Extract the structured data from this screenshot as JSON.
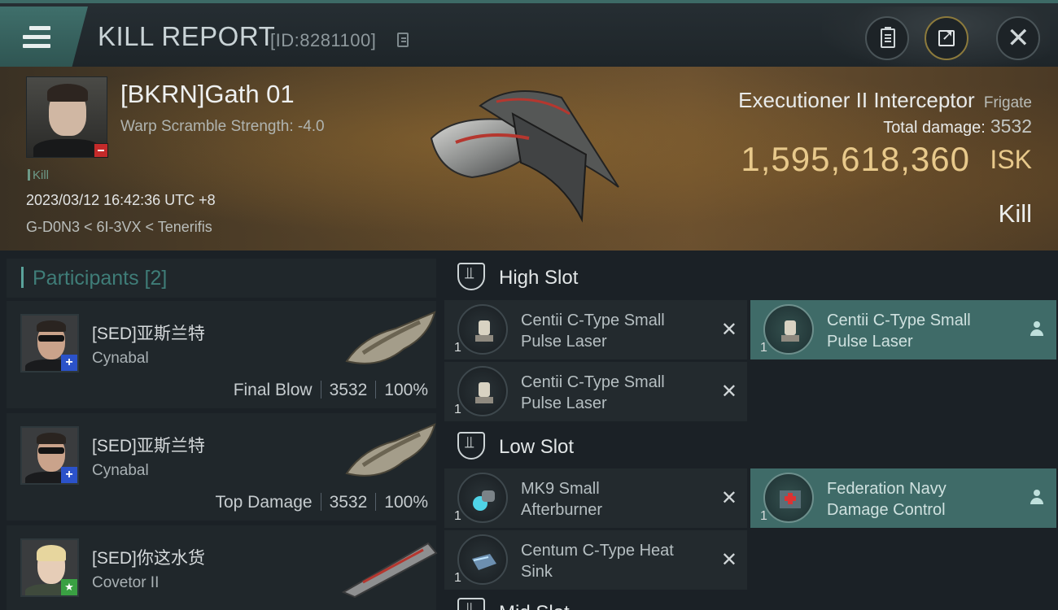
{
  "titlebar": {
    "title": "KILL REPORT",
    "report_id": "[ID:8281100]"
  },
  "victim": {
    "name": "[BKRN]Gath 01",
    "warp_scramble": "Warp Scramble Strength: -4.0",
    "tag": "Kill",
    "timestamp": "2023/03/12 16:42:36 UTC +8",
    "location": "G-D0N3 < 6I-3VX < Tenerifis",
    "ship_type": "Executioner II Interceptor",
    "ship_class": "Frigate",
    "total_damage_label": "Total damage:",
    "total_damage_value": "3532",
    "isk_value": "1,595,618,360",
    "isk_unit": "ISK",
    "result": "Kill"
  },
  "participants": {
    "title": "Participants [2]",
    "items": [
      {
        "name": "[SED]亚斯兰特",
        "ship": "Cynabal",
        "role": "Final Blow",
        "damage": "3532",
        "percent": "100%",
        "standing": "+"
      },
      {
        "name": "[SED]亚斯兰特",
        "ship": "Cynabal",
        "role": "Top Damage",
        "damage": "3532",
        "percent": "100%",
        "standing": "+"
      },
      {
        "name": "[SED]你这水货",
        "ship": "Covetor II",
        "standing": "★"
      }
    ]
  },
  "slots": {
    "high_title": "High Slot",
    "low_title": "Low Slot",
    "mid_title": "Mid Slot",
    "modules": [
      {
        "name_line1": "Centii C-Type Small",
        "name_line2": "Pulse Laser",
        "qty": "1",
        "state": "destroyed",
        "icon": "laser-icon"
      },
      {
        "name_line1": "Centii C-Type Small",
        "name_line2": "Pulse Laser",
        "qty": "1",
        "state": "dropped",
        "icon": "laser-icon"
      },
      {
        "name_line1": "Centii C-Type Small",
        "name_line2": "Pulse Laser",
        "qty": "1",
        "state": "destroyed",
        "icon": "laser-icon"
      },
      {
        "name_line1": "MK9 Small",
        "name_line2": "Afterburner",
        "qty": "1",
        "state": "destroyed",
        "icon": "afterburner-icon"
      },
      {
        "name_line1": "Federation Navy",
        "name_line2": "Damage Control",
        "qty": "1",
        "state": "dropped",
        "icon": "damage-control-icon"
      },
      {
        "name_line1": "Centum C-Type Heat",
        "name_line2": "Sink",
        "qty": "1",
        "state": "destroyed",
        "icon": "heat-sink-icon"
      }
    ]
  },
  "colors": {
    "accent": "#3f6b68",
    "isk": "#e8c98b",
    "hostile_badge": "#c42a2a",
    "blue_standing": "#2b52c9",
    "green_standing": "#3aa043"
  }
}
